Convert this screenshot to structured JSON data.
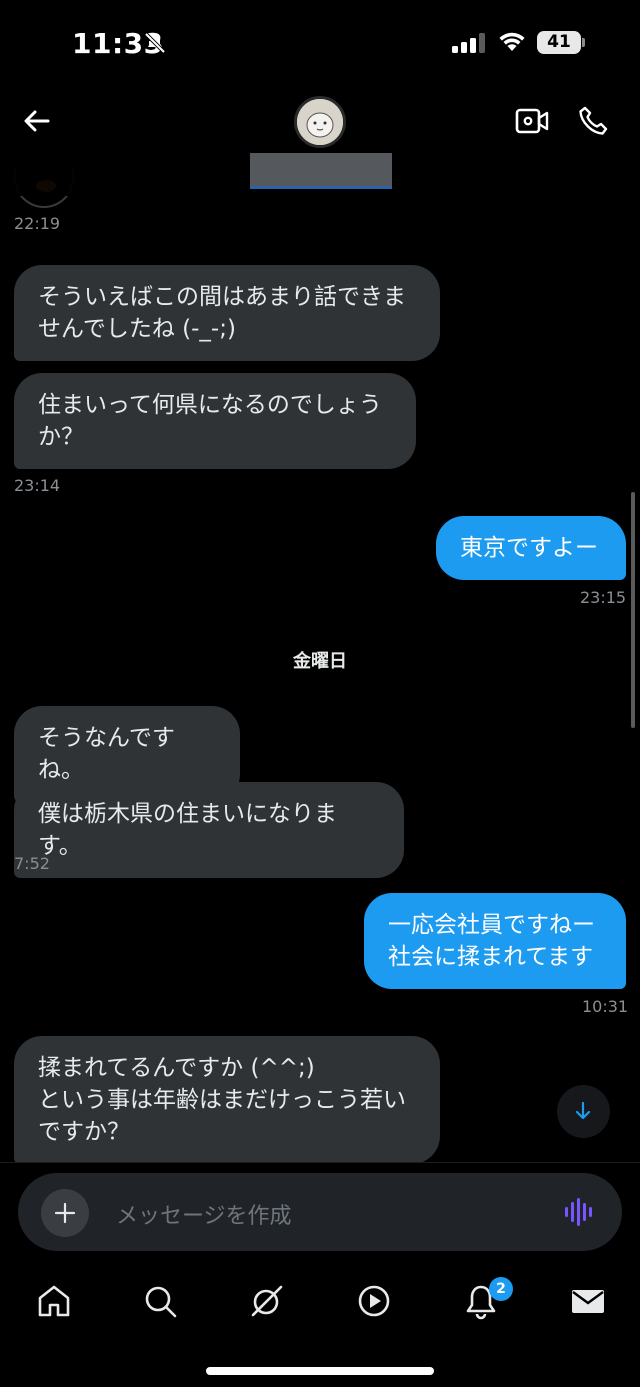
{
  "status": {
    "time": "11:33",
    "battery": "41"
  },
  "header": {
    "back": "back",
    "video": "video-call",
    "phone": "voice-call"
  },
  "messages": [
    {
      "side": "in",
      "text": "そういえばこの間はあまり話できま\nせんでしたね (-_-;)"
    },
    {
      "side": "in",
      "text": "住まいって何県になるのでしょう\nか？"
    },
    {
      "side": "out",
      "text": "東京ですよー"
    },
    {
      "side": "in",
      "text": "そうなんですね。"
    },
    {
      "side": "in",
      "text": "僕は栃木県の住まいになります。"
    },
    {
      "side": "out",
      "text": "一応会社員ですねー\n社会に揉まれてます"
    },
    {
      "side": "in",
      "text": "揉まれてるんですか (^^;)\nという事は年齢はまだけっこう若い\nですか？"
    }
  ],
  "timestamps": [
    "22:19",
    "23:14",
    "23:15",
    "7:52",
    "10:31"
  ],
  "day_separator": "金曜日",
  "composer": {
    "placeholder": "メッセージを作成"
  },
  "tabbar": {
    "items": [
      "home",
      "search",
      "grok",
      "video",
      "notifications",
      "messages"
    ],
    "notification_badge": "2"
  },
  "colors": {
    "accent": "#1d9bf0",
    "incoming_bubble": "#2f3336",
    "background": "#000000"
  }
}
